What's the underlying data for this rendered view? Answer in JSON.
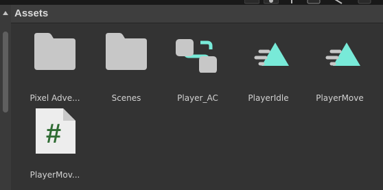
{
  "panel": {
    "title": "Assets"
  },
  "assets": [
    {
      "label": "Pixel Adve...",
      "icon": "folder-icon"
    },
    {
      "label": "Scenes",
      "icon": "folder-icon"
    },
    {
      "label": "Player_AC",
      "icon": "animator-controller-icon"
    },
    {
      "label": "PlayerIdle",
      "icon": "animation-clip-icon"
    },
    {
      "label": "PlayerMove",
      "icon": "animation-clip-icon"
    },
    {
      "label": "PlayerMov...",
      "icon": "csharp-script-icon"
    }
  ],
  "colors": {
    "accent_teal": "#78ead8",
    "script_green": "#2e6b32",
    "folder_gray": "#c7c7c7"
  }
}
